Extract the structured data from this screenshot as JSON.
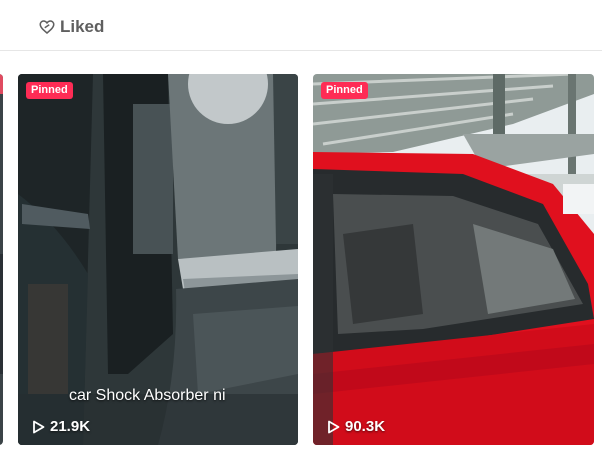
{
  "tabs": {
    "liked": "Liked"
  },
  "videos": [
    {
      "badge": "Pinned",
      "caption": "car Shock Absorber ni",
      "views": "21.9K"
    },
    {
      "badge": "Pinned",
      "views": "90.3K"
    }
  ],
  "icons": {
    "liked": "heart-outline-icon",
    "play": "play-outline-icon"
  },
  "colors": {
    "badge": "#fe2c55",
    "tab_text": "#5f5f5f"
  }
}
